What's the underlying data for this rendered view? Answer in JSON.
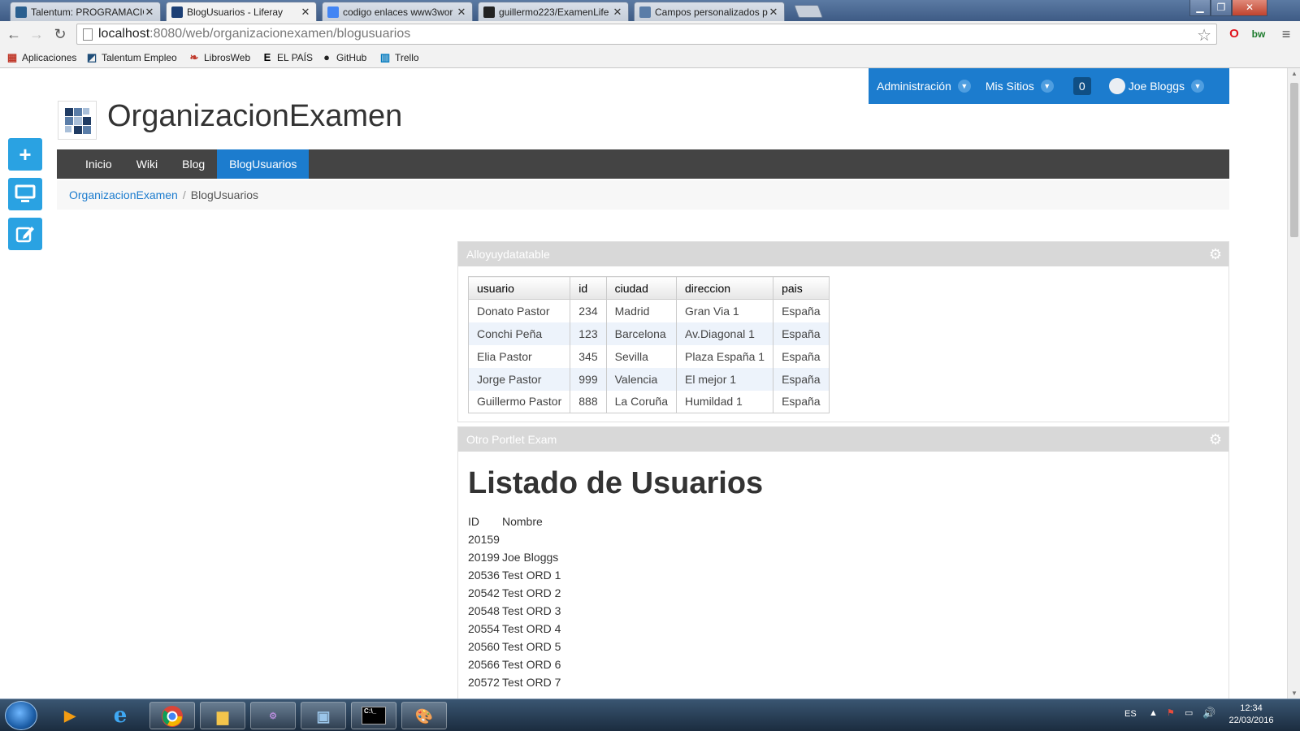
{
  "browser": {
    "tabs": [
      {
        "label": "Talentum: PROGRAMACIÓ",
        "active": false,
        "favicon_color": "#2a5f8f"
      },
      {
        "label": "BlogUsuarios - Liferay",
        "active": true,
        "favicon_color": "#1c3f75"
      },
      {
        "label": "codigo enlaces www3wor",
        "active": false,
        "favicon_color": "#4285f4"
      },
      {
        "label": "guillermo223/ExamenLife",
        "active": false,
        "favicon_color": "#222222"
      },
      {
        "label": "Campos personalizados p",
        "active": false,
        "favicon_color": "#5a7da8"
      }
    ],
    "url_host": "localhost",
    "url_rest": ":8080/web/organizacionexamen/blogusuarios",
    "bookmarks": [
      {
        "label": "Aplicaciones",
        "icon": "apps-grid-icon",
        "color": "#c0392b"
      },
      {
        "label": "Talentum Empleo",
        "icon": "talentum-icon",
        "color": "#1f4e79"
      },
      {
        "label": "LibrosWeb",
        "icon": "librosweb-icon",
        "color": "#c0392b"
      },
      {
        "label": "EL PAÍS",
        "icon": "elpais-icon",
        "color": "#000000"
      },
      {
        "label": "GitHub",
        "icon": "github-icon",
        "color": "#222222"
      },
      {
        "label": "Trello",
        "icon": "trello-icon",
        "color": "#0079bf"
      }
    ]
  },
  "dockbar": {
    "admin_label": "Administración",
    "sites_label": "Mis Sitios",
    "notification_count": "0",
    "user_name": "Joe Bloggs"
  },
  "site": {
    "name": "OrganizacionExamen",
    "nav": [
      "Inicio",
      "Wiki",
      "Blog",
      "BlogUsuarios"
    ],
    "active_nav": "BlogUsuarios",
    "breadcrumb": {
      "parent": "OrganizacionExamen",
      "current": "BlogUsuarios",
      "separator": "/"
    }
  },
  "portlet_table": {
    "title": "Alloyuydatatable",
    "columns": [
      "usuario",
      "id",
      "ciudad",
      "direccion",
      "pais"
    ],
    "rows": [
      [
        "Donato Pastor",
        "234",
        "Madrid",
        "Gran Via 1",
        "España"
      ],
      [
        "Conchi Peña",
        "123",
        "Barcelona",
        "Av.Diagonal 1",
        "España"
      ],
      [
        "Elia Pastor",
        "345",
        "Sevilla",
        "Plaza España 1",
        "España"
      ],
      [
        "Jorge Pastor",
        "999",
        "Valencia",
        "El mejor 1",
        "España"
      ],
      [
        "Guillermo Pastor",
        "888",
        "La Coruña",
        "Humildad 1",
        "España"
      ]
    ]
  },
  "portlet_list": {
    "title": "Otro Portlet Exam",
    "heading": "Listado de Usuarios",
    "header": [
      "ID",
      "Nombre"
    ],
    "rows": [
      [
        "20159",
        ""
      ],
      [
        "20199",
        "Joe Bloggs"
      ],
      [
        "20536",
        "Test ORD 1"
      ],
      [
        "20542",
        "Test ORD 2"
      ],
      [
        "20548",
        "Test ORD 3"
      ],
      [
        "20554",
        "Test ORD 4"
      ],
      [
        "20560",
        "Test ORD 5"
      ],
      [
        "20566",
        "Test ORD 6"
      ],
      [
        "20572",
        "Test ORD 7"
      ]
    ]
  },
  "taskbar": {
    "language": "ES",
    "time": "12:34",
    "date": "22/03/2016"
  },
  "colors": {
    "liferay_blue": "#1c7cce",
    "rail_blue": "#2aa2e2",
    "nav_dark": "#444444"
  }
}
